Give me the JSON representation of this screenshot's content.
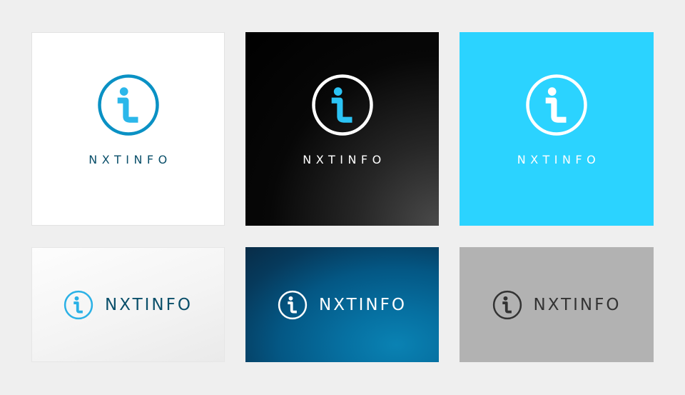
{
  "brand": {
    "name": "NXTINFO"
  },
  "variants": [
    {
      "ring": "#0a91c4",
      "i": "#2bb7ea",
      "text": "#0a4f6a"
    },
    {
      "ring": "#ffffff",
      "i": "#2bc3f4",
      "text": "#ffffff"
    },
    {
      "ring": "#ffffff",
      "i": "#ffffff",
      "text": "#ffffff"
    },
    {
      "ring": "#2bb1e6",
      "i": "#2bb1e6",
      "text": "#0a4f6a"
    },
    {
      "ring": "#ffffff",
      "i": "#ffffff",
      "text": "#ffffff"
    },
    {
      "ring": "#333333",
      "i": "#333333",
      "text": "#333333"
    }
  ],
  "icon": "info-i-circle-icon"
}
